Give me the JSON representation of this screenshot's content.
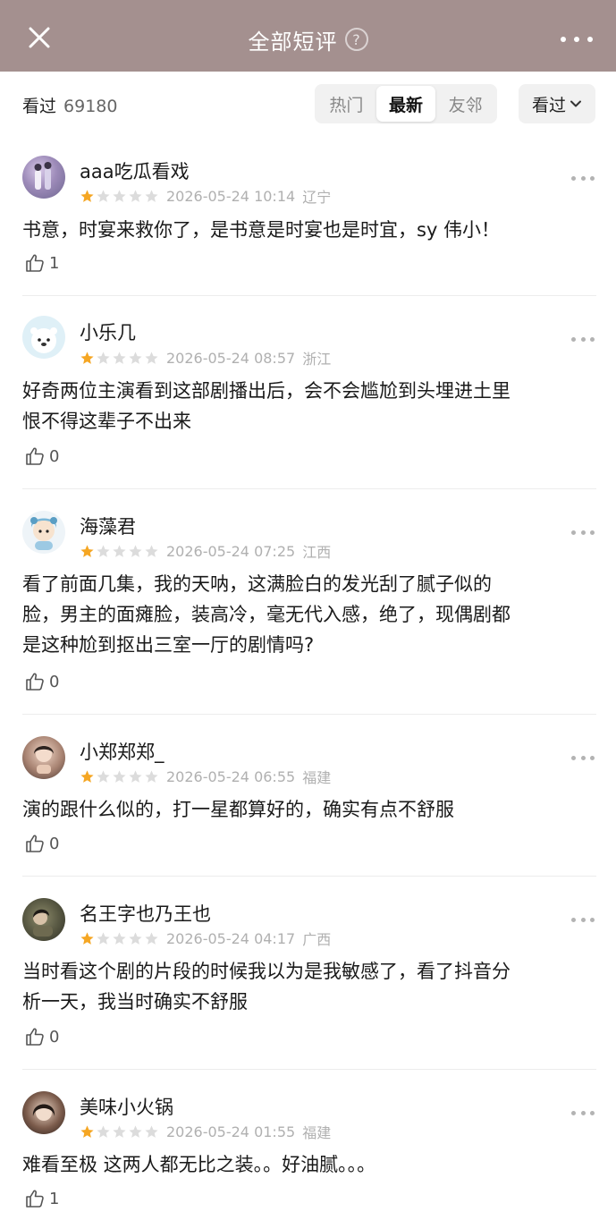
{
  "header": {
    "title": "全部短评",
    "help_symbol": "?"
  },
  "filter": {
    "seen_label": "看过",
    "seen_count": "69180",
    "tabs": [
      {
        "label": "热门",
        "active": false
      },
      {
        "label": "最新",
        "active": true
      },
      {
        "label": "友邻",
        "active": false
      }
    ],
    "dropdown_label": "看过"
  },
  "colors": {
    "header_bg": "#a4908f",
    "star_filled": "#f5a623",
    "star_empty": "#dcdcdc"
  },
  "reviews": [
    {
      "username": "aaa吃瓜看戏",
      "rating": 1,
      "datetime": "2026-05-24 10:14",
      "location": "辽宁",
      "lines": [
        "书意，时宴来救你了，是书意是时宴也是时宜，sy 伟小！"
      ],
      "likes": "1"
    },
    {
      "username": "小乐几",
      "rating": 1,
      "datetime": "2026-05-24 08:57",
      "location": "浙江",
      "lines": [
        "好奇两位主演看到这部剧播出后，会不会尴尬到头埋进土里",
        "恨不得这辈子不出来"
      ],
      "likes": "0"
    },
    {
      "username": "海藻君",
      "rating": 1,
      "datetime": "2026-05-24 07:25",
      "location": "江西",
      "lines": [
        "看了前面几集，我的天呐，这满脸白的发光刮了腻子似的",
        "脸，男主的面瘫脸，装高冷，毫无代入感，绝了，现偶剧都",
        "是这种尬到抠出三室一厅的剧情吗?"
      ],
      "likes": "0"
    },
    {
      "username": "小郑郑郑_",
      "rating": 1,
      "datetime": "2026-05-24 06:55",
      "location": "福建",
      "lines": [
        "演的跟什么似的，打一星都算好的，确实有点不舒服"
      ],
      "likes": "0"
    },
    {
      "username": "名王字也乃王也",
      "rating": 1,
      "datetime": "2026-05-24 04:17",
      "location": "广西",
      "lines": [
        "当时看这个剧的片段的时候我以为是我敏感了，看了抖音分",
        "析一天，我当时确实不舒服"
      ],
      "likes": "0"
    },
    {
      "username": "美味小火锅",
      "rating": 1,
      "datetime": "2026-05-24 01:55",
      "location": "福建",
      "lines": [
        "难看至极 这两人都无比之装。。好油腻。。。"
      ],
      "likes": "1"
    }
  ]
}
